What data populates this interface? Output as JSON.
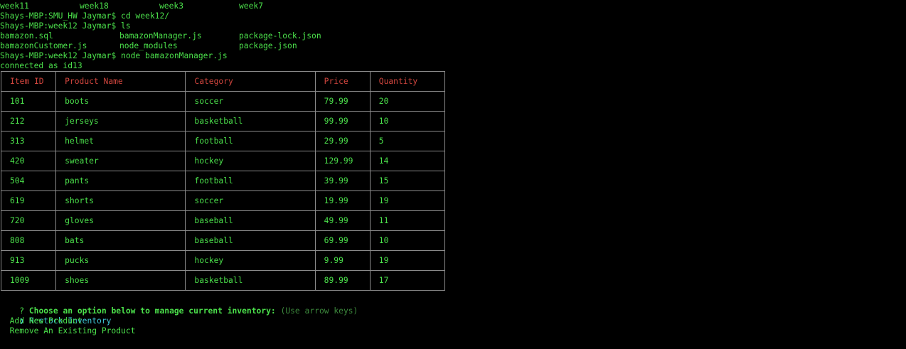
{
  "terminal": {
    "ls_dirs_row": [
      "week11",
      "week18",
      "week3",
      "week7"
    ],
    "cmd_cd": "Shays-MBP:SMU_HW Jaymar$ cd week12/",
    "cmd_ls": "Shays-MBP:week12 Jaymar$ ls",
    "ls_files_row1": [
      "bamazon.sql",
      "bamazonManager.js",
      "package-lock.json"
    ],
    "ls_files_row2": [
      "bamazonCustomer.js",
      "node_modules",
      "package.json"
    ],
    "cmd_node": "Shays-MBP:week12 Jaymar$ node bamazonManager.js",
    "connected": "connected as id13"
  },
  "table": {
    "headers": [
      "Item ID",
      "Product Name",
      "Category",
      "Price",
      "Quantity"
    ],
    "rows": [
      [
        "101",
        "boots",
        "soccer",
        "79.99",
        "20"
      ],
      [
        "212",
        "jerseys",
        "basketball",
        "99.99",
        "10"
      ],
      [
        "313",
        "helmet",
        "football",
        "29.99",
        "5"
      ],
      [
        "420",
        "sweater",
        "hockey",
        "129.99",
        "14"
      ],
      [
        "504",
        "pants",
        "football",
        "39.99",
        "15"
      ],
      [
        "619",
        "shorts",
        "soccer",
        "19.99",
        "19"
      ],
      [
        "720",
        "gloves",
        "baseball",
        "49.99",
        "11"
      ],
      [
        "808",
        "bats",
        "baseball",
        "69.99",
        "10"
      ],
      [
        "913",
        "pucks",
        "hockey",
        "9.99",
        "19"
      ],
      [
        "1009",
        "shoes",
        "basketball",
        "89.99",
        "17"
      ]
    ]
  },
  "prompt": {
    "question_mark": "?",
    "message": "Choose an option below to manage current inventory:",
    "hint": "(Use arrow keys)",
    "pointer_icon": "❯",
    "choices": [
      "Restock Inventory",
      "Add New Product",
      "Remove An Existing Product"
    ],
    "selected_index": 0
  },
  "colors": {
    "background": "#000000",
    "text_green": "#4be04b",
    "header_red": "#d2463e",
    "selected_cyan": "#3fc8d8",
    "hint_dim_green": "#3d8a3d",
    "table_border": "#8a8a8a"
  }
}
